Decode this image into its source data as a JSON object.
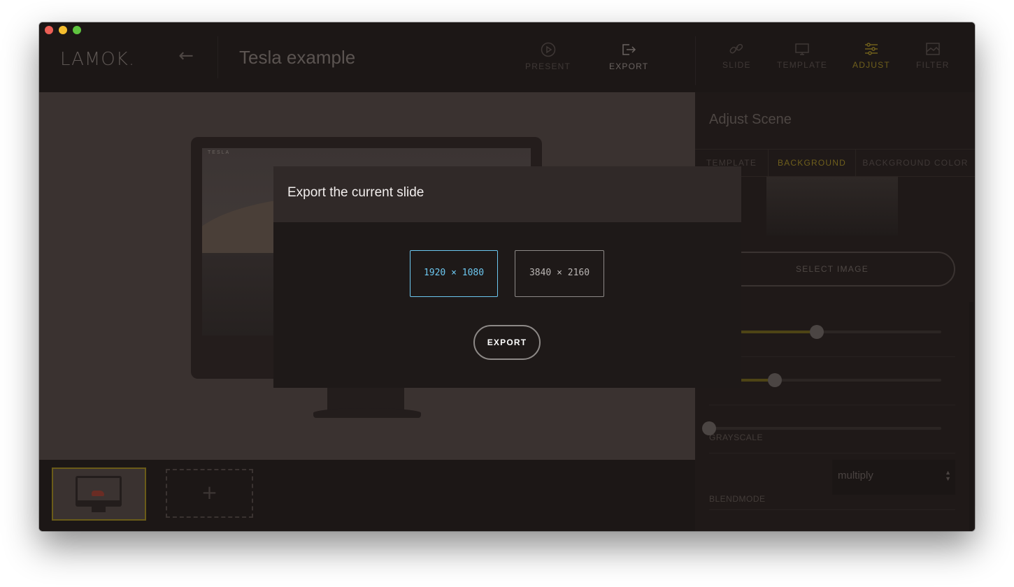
{
  "app": {
    "logo_text": "LAMOK.",
    "document_title": "Tesla example"
  },
  "toolbar": {
    "present_label": "PRESENT",
    "export_label": "EXPORT",
    "slide_label": "SLIDE",
    "template_label": "TEMPLATE",
    "adjust_label": "ADJUST",
    "filter_label": "FILTER",
    "active_tool": "ADJUST"
  },
  "preview": {
    "screen_nav_text": "TESLA"
  },
  "panel": {
    "title": "Adjust Scene",
    "tabs": [
      {
        "label": "TEMPLATE",
        "active": false
      },
      {
        "label": "BACKGROUND",
        "active": true
      },
      {
        "label": "BACKGROUND COLOR",
        "active": false
      }
    ],
    "select_image_label": "SELECT IMAGE",
    "sliders": [
      {
        "value_fraction": 0.46
      },
      {
        "value_fraction": 0.25
      },
      {
        "label": "GRAYSCALE",
        "value_fraction": 0.0
      }
    ],
    "blendmode_label": "BLENDMODE",
    "blendmode_value": "multiply"
  },
  "filmstrip": {
    "add_slide_icon": "+"
  },
  "modal": {
    "title": "Export the current slide",
    "resolutions": [
      {
        "label": "1920 × 1080",
        "selected": true
      },
      {
        "label": "3840 × 2160",
        "selected": false
      }
    ],
    "export_button_label": "EXPORT"
  },
  "colors": {
    "accent_selected": "#6cc7f0",
    "active_tab": "#6f5f1c",
    "slider_fill": "#4e4415",
    "close": "#ec5f56",
    "minimize": "#f4bd2e",
    "maximize": "#5fc43f"
  }
}
